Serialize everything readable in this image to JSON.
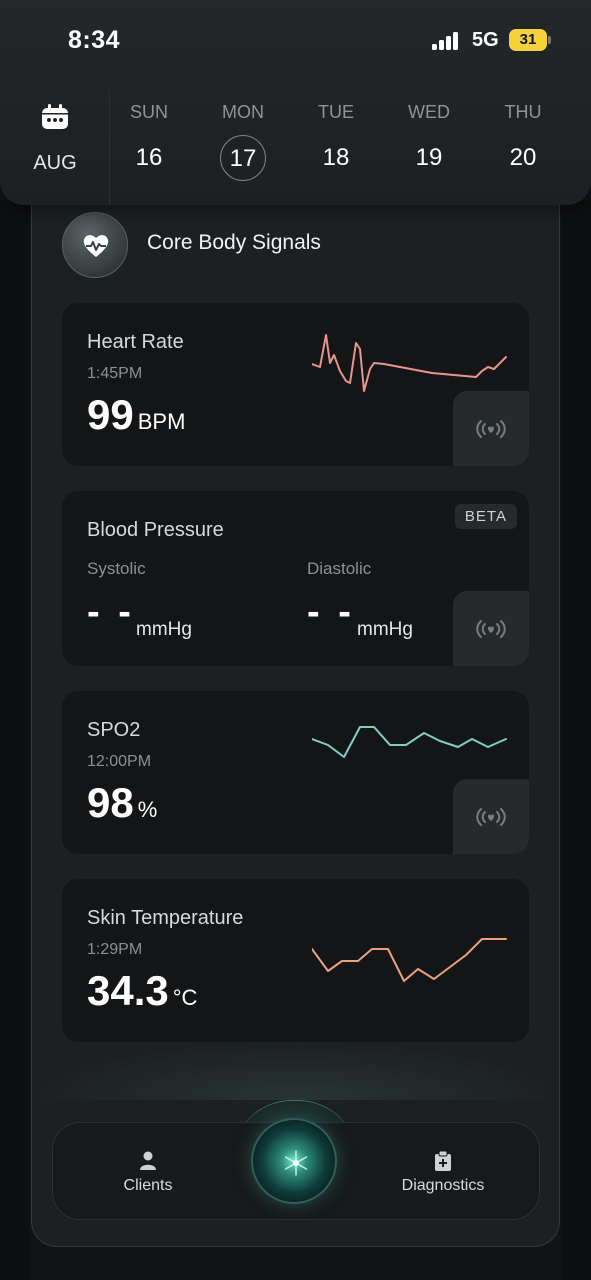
{
  "status_bar": {
    "time": "8:34",
    "network": "5G",
    "battery": "31"
  },
  "calendar": {
    "month": "AUG",
    "days": [
      {
        "name": "SUN",
        "num": "16",
        "selected": false
      },
      {
        "name": "MON",
        "num": "17",
        "selected": true
      },
      {
        "name": "TUE",
        "num": "18",
        "selected": false
      },
      {
        "name": "WED",
        "num": "19",
        "selected": false
      },
      {
        "name": "THU",
        "num": "20",
        "selected": false
      }
    ]
  },
  "section": {
    "title": "Core Body Signals",
    "icon": "heart-pulse-icon"
  },
  "heart_rate": {
    "title": "Heart Rate",
    "time": "1:45PM",
    "value": "99",
    "unit": "BPM",
    "line_color": "#e8958a",
    "icon": "live-signal-icon"
  },
  "blood_pressure": {
    "title": "Blood Pressure",
    "badge": "BETA",
    "systolic_label": "Systolic",
    "systolic_value": "- -",
    "diastolic_label": "Diastolic",
    "diastolic_value": "- -",
    "unit": "mmHg",
    "icon": "live-signal-icon"
  },
  "spo2": {
    "title": "SPO2",
    "time": "12:00PM",
    "value": "98",
    "unit": "%",
    "line_color": "#7fcfc7",
    "icon": "live-signal-icon"
  },
  "skin_temp": {
    "title": "Skin Temperature",
    "time": "1:29PM",
    "value": "34.3",
    "unit": "°C",
    "line_color": "#e9a27d"
  },
  "nav": {
    "left_label": "Clients",
    "right_label": "Diagnostics",
    "left_icon": "person-icon",
    "right_icon": "clipboard-medical-icon",
    "center_icon": "ai-orb-icon"
  }
}
